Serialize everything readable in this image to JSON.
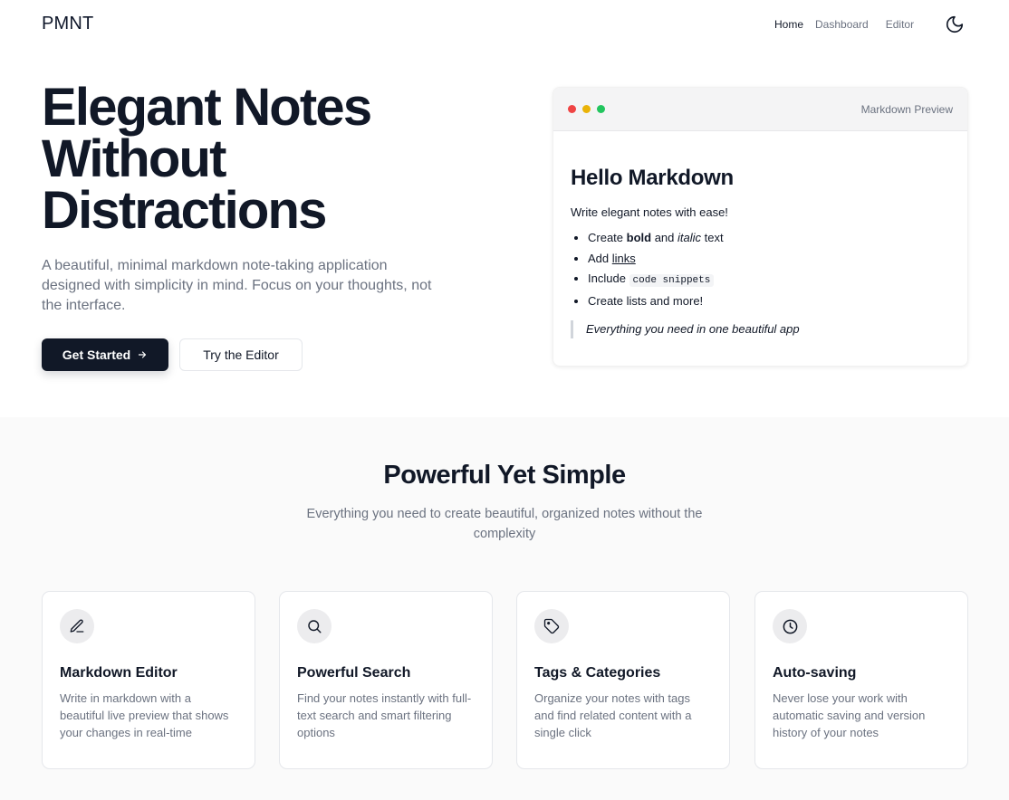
{
  "nav": {
    "logo": "PMNT",
    "links": [
      {
        "label": "Home",
        "active": true
      },
      {
        "label": "Dashboard",
        "active": false
      },
      {
        "label": "Editor",
        "active": false
      }
    ],
    "theme_icon": "moon-icon"
  },
  "hero": {
    "title_line1": "Elegant Notes",
    "title_line2": "Without",
    "title_line3": "Distractions",
    "subtitle": "A beautiful, minimal markdown note-taking application designed with simplicity in mind. Focus on your thoughts, not the interface.",
    "primary_button": "Get Started",
    "primary_icon": "arrow-right-icon",
    "secondary_button": "Try the Editor"
  },
  "preview": {
    "label": "Markdown Preview",
    "heading": "Hello Markdown",
    "paragraph": "Write elegant notes with ease!",
    "item1": {
      "pre": "Create ",
      "bold": "bold",
      "mid": " and ",
      "italic": "italic",
      "post": " text"
    },
    "item2": {
      "pre": "Add ",
      "link": "links"
    },
    "item3": {
      "pre": "Include ",
      "code": "code snippets"
    },
    "item4": "Create lists and more!",
    "quote": "Everything you need in one beautiful app"
  },
  "features": {
    "title": "Powerful Yet Simple",
    "subtitle": "Everything you need to create beautiful, organized notes without the complexity",
    "cards": [
      {
        "icon": "pencil-icon",
        "title": "Markdown Editor",
        "desc": "Write in markdown with a beautiful live preview that shows your changes in real-time"
      },
      {
        "icon": "search-icon",
        "title": "Powerful Search",
        "desc": "Find your notes instantly with full-text search and smart filtering options"
      },
      {
        "icon": "tag-icon",
        "title": "Tags & Categories",
        "desc": "Organize your notes with tags and find related content with a single click"
      },
      {
        "icon": "clock-icon",
        "title": "Auto-saving",
        "desc": "Never lose your work with automatic saving and version history of your notes"
      }
    ]
  },
  "colors": {
    "primary": "#111827",
    "muted_text": "#6b7280",
    "dot_red": "#ef4444",
    "dot_yellow": "#eab308",
    "dot_green": "#22c55e"
  }
}
